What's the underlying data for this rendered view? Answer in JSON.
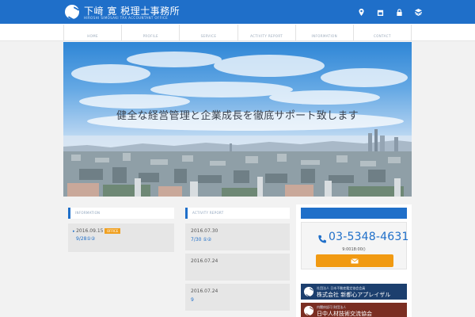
{
  "header": {
    "brand_name": "下﨑 寛 税理士事務所",
    "brand_sub": "HIROSHI SIMOSAKI TAX ACCOUNTANT OFFICE",
    "icons": [
      "map-pin-icon",
      "calendar-icon",
      "lock-icon",
      "stack-icon"
    ]
  },
  "nav": {
    "items": [
      {
        "label": "HOME"
      },
      {
        "label": "PROFILE"
      },
      {
        "label": "SERVICE"
      },
      {
        "label": "ACTIVITY REPORT"
      },
      {
        "label": "INFORMATION"
      },
      {
        "label": "CONTACT"
      }
    ]
  },
  "hero": {
    "headline": "健全な経営管理と企業成長を徹底サポート致します"
  },
  "information": {
    "heading": "INFORMATION",
    "items": [
      {
        "date": "2016.09.15",
        "badge": "OFFICE",
        "title": "9/28①②"
      }
    ]
  },
  "activity": {
    "heading": "ACTIVITY REPORT",
    "items": [
      {
        "date": "2016.07.30",
        "title": "7/30 ①②"
      },
      {
        "date": "2016.07.24",
        "title": ""
      },
      {
        "date": "2016.07.24",
        "title": "9"
      }
    ]
  },
  "contact": {
    "phone": "03-5348-4631",
    "hours": "9:0018:00()",
    "banners": [
      {
        "sub": "社団法人 日本不動産鑑定協会会員",
        "main": "株式会社 新都心アプレイザル"
      },
      {
        "sub": "内閣府認可 財団法人",
        "main": "日中人材技術交流協会"
      }
    ]
  },
  "colors": {
    "primary": "#1f6fc9",
    "accent": "#f19a12",
    "banner_navy": "#1c3f6e",
    "banner_red": "#7a2e22"
  }
}
